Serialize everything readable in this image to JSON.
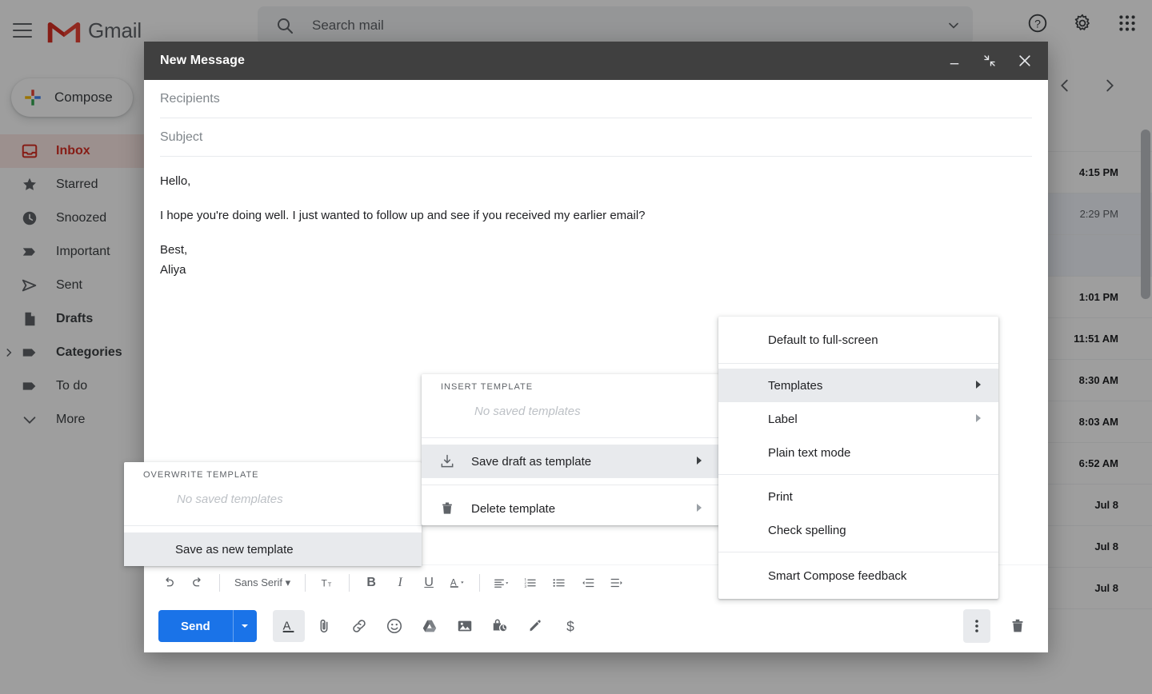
{
  "app": {
    "brand": "Gmail",
    "hamburger_icon": "hamburger-icon",
    "search": {
      "placeholder": "Search mail",
      "value": "",
      "search_icon": "search-icon",
      "options_icon": "chevron-down-icon"
    },
    "topbar_icons": [
      {
        "name": "help-icon",
        "label": "Support"
      },
      {
        "name": "gear-icon",
        "label": "Settings"
      },
      {
        "name": "apps-grid-icon",
        "label": "Google apps"
      }
    ],
    "compose_button": {
      "label": "Compose",
      "icon": "plus-icon"
    },
    "nav_items": [
      {
        "label": "Inbox",
        "icon": "inbox-icon",
        "active": true,
        "bold": true,
        "expandable": false
      },
      {
        "label": "Starred",
        "icon": "star-icon",
        "active": false,
        "bold": false,
        "expandable": false
      },
      {
        "label": "Snoozed",
        "icon": "clock-icon",
        "active": false,
        "bold": false,
        "expandable": false
      },
      {
        "label": "Important",
        "icon": "important-icon",
        "active": false,
        "bold": false,
        "expandable": false
      },
      {
        "label": "Sent",
        "icon": "send-icon",
        "active": false,
        "bold": false,
        "expandable": false
      },
      {
        "label": "Drafts",
        "icon": "draft-icon",
        "active": false,
        "bold": true,
        "expandable": false
      },
      {
        "label": "Categories",
        "icon": "label-icon",
        "active": false,
        "bold": true,
        "expandable": true
      },
      {
        "label": "To do",
        "icon": "label-icon",
        "active": false,
        "bold": false,
        "expandable": false
      },
      {
        "label": "More",
        "icon": "chevron-down-icon",
        "active": false,
        "bold": false,
        "expandable": false
      }
    ],
    "list_toolbar": {
      "prev_icon": "chevron-left-icon",
      "next_icon": "chevron-right-icon"
    },
    "mail_rows": [
      {
        "time": "",
        "read": false
      },
      {
        "time": "4:15 PM",
        "read": false
      },
      {
        "time": "2:29 PM",
        "read": true
      },
      {
        "time": "1:01 PM",
        "read": false
      },
      {
        "time": "11:51 AM",
        "read": false
      },
      {
        "time": "8:30 AM",
        "read": false
      },
      {
        "time": "8:03 AM",
        "read": false
      },
      {
        "time": "6:52 AM",
        "read": false
      },
      {
        "time": "Jul 8",
        "read": false
      },
      {
        "time": "Jul 8",
        "read": false
      },
      {
        "time": "",
        "read": false
      },
      {
        "time": "Jul 8",
        "read": false
      }
    ]
  },
  "compose": {
    "title": "New Message",
    "window_buttons": [
      {
        "name": "minimize-icon",
        "label": "Minimize"
      },
      {
        "name": "exit-full-screen-icon",
        "label": "Exit full screen"
      },
      {
        "name": "close-icon",
        "label": "Save & close"
      }
    ],
    "recipients": {
      "placeholder": "Recipients",
      "value": ""
    },
    "subject": {
      "placeholder": "Subject",
      "value": ""
    },
    "body_lines": [
      "Hello,",
      "I hope you're doing well. I just wanted to follow up and see if you received my earlier email?",
      "Best,",
      "Aliya"
    ],
    "format_toolbar": [
      {
        "name": "undo-icon",
        "glyph": "↶"
      },
      {
        "name": "redo-icon",
        "glyph": "↷"
      },
      {
        "name": "font-family-icon",
        "glyph": "Sans Serif"
      },
      {
        "name": "font-size-icon",
        "glyph": "T"
      },
      {
        "name": "bold-icon",
        "glyph": "B"
      },
      {
        "name": "italic-icon",
        "glyph": "I"
      },
      {
        "name": "underline-icon",
        "glyph": "U"
      },
      {
        "name": "text-color-icon",
        "glyph": "A"
      },
      {
        "name": "align-icon",
        "glyph": "≡"
      },
      {
        "name": "numbered-list-icon",
        "glyph": "1≡"
      },
      {
        "name": "bulleted-list-icon",
        "glyph": "•≡"
      },
      {
        "name": "indent-less-icon",
        "glyph": "⇤"
      },
      {
        "name": "indent-more-icon",
        "glyph": "⇥"
      }
    ],
    "send": {
      "label": "Send",
      "caret_icon": "chevron-down-icon"
    },
    "tool_icons": [
      {
        "name": "formatting-options-icon",
        "label": "Formatting options",
        "selected": true
      },
      {
        "name": "attach-file-icon",
        "label": "Attach files",
        "selected": false
      },
      {
        "name": "insert-link-icon",
        "label": "Insert link",
        "selected": false
      },
      {
        "name": "insert-emoji-icon",
        "label": "Insert emoji",
        "selected": false
      },
      {
        "name": "insert-drive-icon",
        "label": "Insert files using Drive",
        "selected": false
      },
      {
        "name": "insert-photo-icon",
        "label": "Insert photo",
        "selected": false
      },
      {
        "name": "confidential-mode-icon",
        "label": "Toggle confidential mode",
        "selected": false
      },
      {
        "name": "insert-signature-icon",
        "label": "Insert signature",
        "selected": false
      },
      {
        "name": "request-money-icon",
        "label": "Insert payment",
        "selected": false
      }
    ],
    "more_options_icon": "more-options-icon",
    "discard_icon": "trash-icon"
  },
  "menus": {
    "more_options": {
      "items": [
        {
          "label": "Default to full-screen",
          "submenu": false,
          "highlighted": false
        },
        {
          "label": "Templates",
          "submenu": true,
          "highlighted": true
        },
        {
          "label": "Label",
          "submenu": true,
          "highlighted": false
        },
        {
          "label": "Plain text mode",
          "submenu": false,
          "highlighted": false
        },
        {
          "label": "Print",
          "submenu": false,
          "highlighted": false
        },
        {
          "label": "Check spelling",
          "submenu": false,
          "highlighted": false
        },
        {
          "label": "Smart Compose feedback",
          "submenu": false,
          "highlighted": false
        }
      ]
    },
    "templates": {
      "section_title": "INSERT TEMPLATE",
      "empty_text": "No saved templates",
      "items": [
        {
          "label": "Save draft as template",
          "icon": "save-draft-icon",
          "submenu": true,
          "highlighted": true
        },
        {
          "label": "Delete template",
          "icon": "trash-icon",
          "submenu": true,
          "highlighted": false
        }
      ]
    },
    "save_draft": {
      "section_title": "OVERWRITE TEMPLATE",
      "empty_text": "No saved templates",
      "items": [
        {
          "label": "Save as new template",
          "submenu": false,
          "highlighted": true
        }
      ]
    }
  }
}
